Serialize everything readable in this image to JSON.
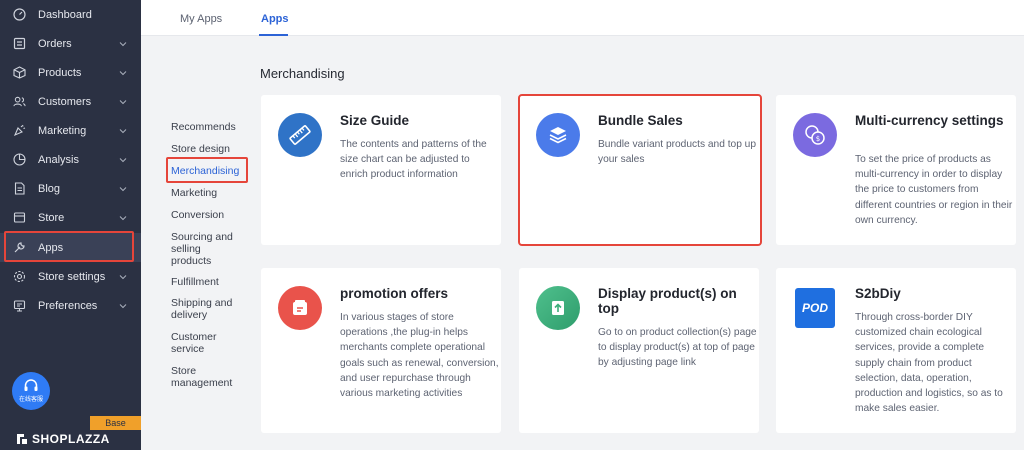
{
  "sidebar": {
    "items": [
      {
        "label": "Dashboard",
        "icon": "dashboard-icon",
        "has_chevron": false
      },
      {
        "label": "Orders",
        "icon": "orders-icon",
        "has_chevron": true
      },
      {
        "label": "Products",
        "icon": "products-icon",
        "has_chevron": true
      },
      {
        "label": "Customers",
        "icon": "customers-icon",
        "has_chevron": true
      },
      {
        "label": "Marketing",
        "icon": "marketing-icon",
        "has_chevron": true
      },
      {
        "label": "Analysis",
        "icon": "analysis-icon",
        "has_chevron": true
      },
      {
        "label": "Blog",
        "icon": "blog-icon",
        "has_chevron": true
      },
      {
        "label": "Store",
        "icon": "store-icon",
        "has_chevron": true
      },
      {
        "label": "Apps",
        "icon": "apps-icon",
        "has_chevron": false
      },
      {
        "label": "Store settings",
        "icon": "settings-icon",
        "has_chevron": true
      },
      {
        "label": "Preferences",
        "icon": "preferences-icon",
        "has_chevron": true
      }
    ],
    "support_label": "在线客服",
    "plan_badge": "Base",
    "brand": "SHOPLAZZA"
  },
  "tabs": [
    {
      "label": "My Apps",
      "active": false
    },
    {
      "label": "Apps",
      "active": true
    }
  ],
  "categories": [
    "Recommends",
    "Store design",
    "Merchandising",
    "Marketing",
    "Conversion",
    "Sourcing and selling products",
    "Fulfillment",
    "Shipping and delivery",
    "Customer service",
    "Store management"
  ],
  "active_category": "Merchandising",
  "section_title": "Merchandising",
  "apps": [
    {
      "title": "Size Guide",
      "desc": "The contents and patterns of the size chart can be adjusted to enrich product information",
      "icon": "ruler-icon",
      "color": "#2f73c7"
    },
    {
      "title": "Bundle Sales",
      "desc": "Bundle variant products and top up your sales",
      "icon": "layers-icon",
      "color": "#4b7bea"
    },
    {
      "title": "Multi-currency settings",
      "desc": "To set the price of products as multi-currency in order to display the price to customers from different countries or region in their own currency.",
      "icon": "currency-icon",
      "color": "#7b6ae0"
    },
    {
      "title": "promotion offers",
      "desc": "In various stages of store operations ,the plug-in helps merchants complete operational goals such as renewal, conversion, and user repurchase through various marketing activities",
      "icon": "promotion-icon",
      "color": "#e9534b"
    },
    {
      "title": "Display product(s) on top",
      "desc": "Go to on product collection(s) page to display product(s) at top of page by adjusting page link",
      "icon": "pin-top-icon",
      "color": "#3cae7a"
    },
    {
      "title": "S2bDiy",
      "desc": "Through cross-border DIY customized chain ecological services, provide a complete supply chain from product selection, data, operation, production and logistics, so as to make sales easier.",
      "icon": "pod-logo",
      "logo_text": "POD",
      "color": "#1f6fe0"
    }
  ]
}
